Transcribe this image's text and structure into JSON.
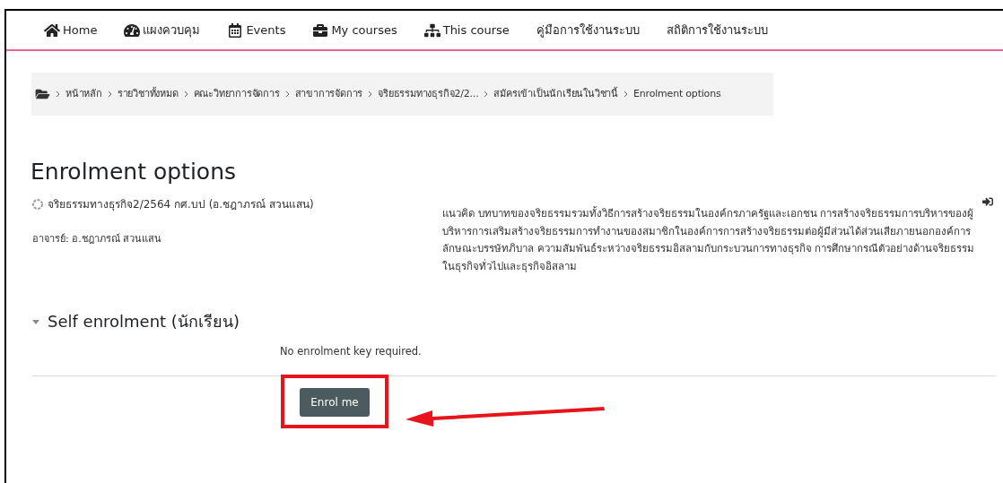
{
  "nav": {
    "items": [
      {
        "label": "Home"
      },
      {
        "label": "แผงควบคุม"
      },
      {
        "label": "Events"
      },
      {
        "label": "My courses"
      },
      {
        "label": "This course"
      },
      {
        "label": "คู่มือการใช้งานระบบ"
      },
      {
        "label": "สถิติการใช้งานระบบ"
      }
    ]
  },
  "breadcrumb": [
    "หน้าหลัก",
    "รายวิชาทั้งหมด",
    "คณะวิทยาการจัดการ",
    "สาขาการจัดการ",
    "จริยธรรมทางธุรกิจ2/2...",
    "สมัครเข้าเป็นนักเรียนในวิชานี้",
    "Enrolment options"
  ],
  "heading": "Enrolment options",
  "course": {
    "name": "จริยธรรมทางธุรกิจ2/2564 กศ.บป (อ.ชฎาภรณ์ สวนแสน)",
    "teacher": "อาจารย์: อ.ชฎาภรณ์ สวนแสน",
    "summary": "แนวคิด บทบาทของจริยธรรมรวมทั้งวิธีการสร้างจริยธรรมในองค์กรภาครัฐและเอกชน การสร้างจริยธรรมการบริหารของผู้บริหารการเสริมสร้างจริยธรรมการทำงานของสมาชิกในองค์การการสร้างจริยธรรมต่อผู้มีส่วนได้ส่วนเสียภายนอกองค์การลักษณะบรรษัทภิบาล ความสัมพันธ์ระหว่างจริยธรรมอิสลามกับกระบวนการทางธุรกิจ การศึกษากรณีตัวอย่างด้านจริยธรรมในธุรกิจทั่วไปและธุรกิจอิสลาม"
  },
  "enrolment": {
    "title": "Self enrolment (นักเรียน)",
    "expanded": true,
    "note": "No enrolment key required.",
    "button": "Enrol me"
  }
}
